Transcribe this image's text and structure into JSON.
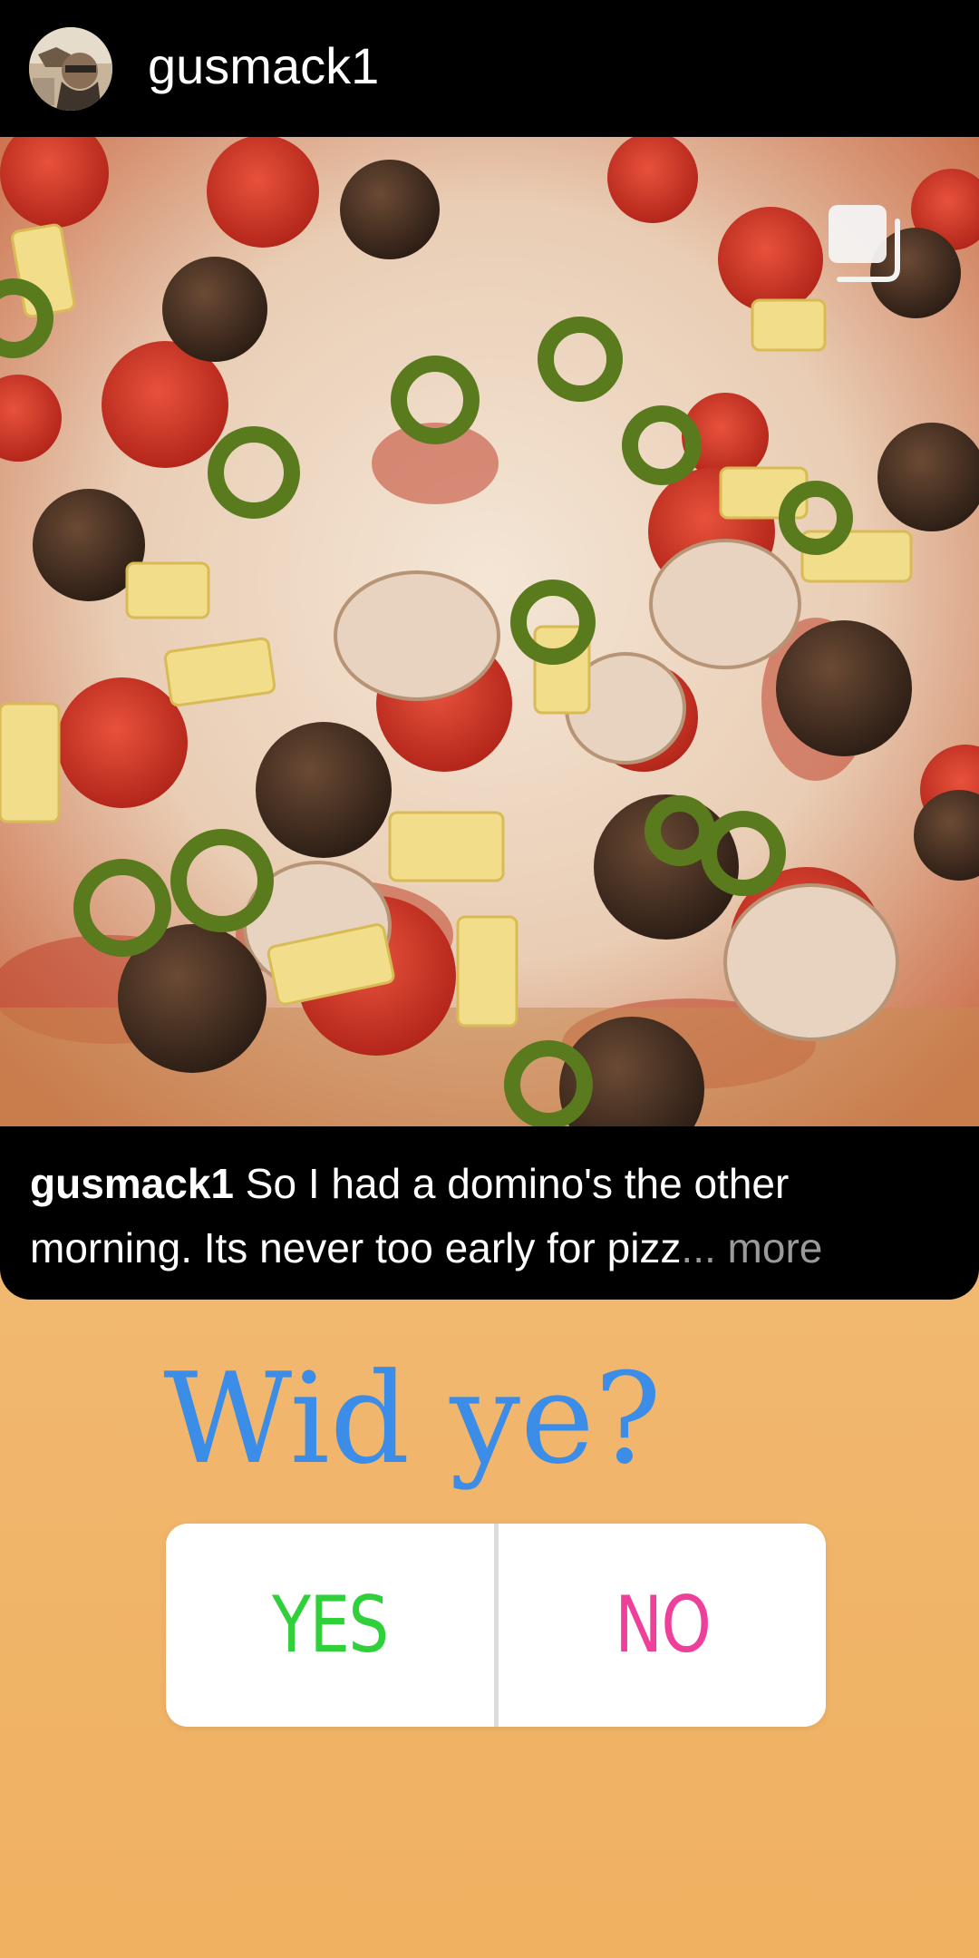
{
  "post": {
    "username": "gusmack1",
    "caption": {
      "username": "gusmack1",
      "text": " So I had a domino's the other morning. Its never too early for pizz",
      "ellipsis": "...",
      "more": " more"
    }
  },
  "poll": {
    "question": "Wid ye?",
    "options": [
      {
        "label": "YES",
        "color": "#2fd03a"
      },
      {
        "label": "NO",
        "color": "#ee3f9b"
      }
    ],
    "question_color": "#3b8de8"
  },
  "icons": {
    "avatar": "profile-avatar",
    "carousel": "multiple-photos-icon"
  }
}
